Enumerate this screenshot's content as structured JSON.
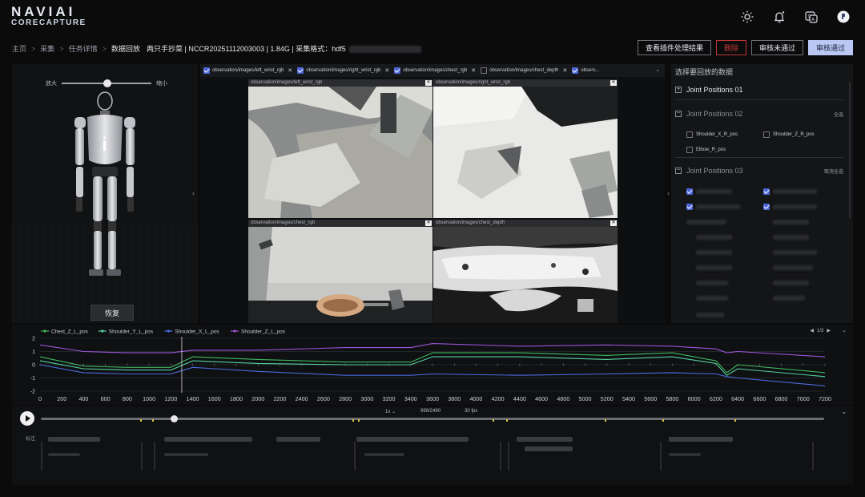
{
  "brand": {
    "line1": "NAVIAI",
    "line2": "CORECAPTURE"
  },
  "header_icons": [
    "sun-icon",
    "bell-icon",
    "translate-icon",
    "avatar"
  ],
  "breadcrumb": [
    {
      "label": "主页"
    },
    {
      "label": "采集"
    },
    {
      "label": "任务详情"
    },
    {
      "label": "数据回放"
    }
  ],
  "task_info": "两只手抄菜 | NCCR20251112003003 | 1.84G | 采集格式：hdf5",
  "actions": {
    "view_plugin": "查看插件处理结果",
    "delete": "删除",
    "reject": "审核未通过",
    "approve": "审核通过"
  },
  "robot_panel": {
    "zoom_in_label": "放大",
    "zoom_out_label": "缩小",
    "zoom_level": 0.5,
    "reset_label": "恢复"
  },
  "camera_tabs": [
    {
      "label": "observation/images/left_wrist_rgb",
      "checked": true
    },
    {
      "label": "observation/images/right_wrist_rgb",
      "checked": true
    },
    {
      "label": "observation/images/chest_rgb",
      "checked": true
    },
    {
      "label": "observation/images/chest_depth",
      "checked": false
    },
    {
      "label": "observ...",
      "checked": true
    }
  ],
  "camera_views": [
    {
      "title": "observation/images/left_wrist_rgb"
    },
    {
      "title": "observation/images/right_wrist_rgb"
    },
    {
      "title": "observation/images/chest_rgb"
    },
    {
      "title": "observation/images/chest_depth"
    }
  ],
  "data_panel": {
    "title": "选择要回放的数据",
    "group1": {
      "name": "Joint Positions 01",
      "toggle": "+"
    },
    "group2": {
      "name": "Joint Positions 02",
      "toggle": "−",
      "action": "全选",
      "options": [
        {
          "label": "Shoulder_X_R_pos",
          "checked": false
        },
        {
          "label": "Shoulder_Z_R_pos",
          "checked": false
        },
        {
          "label": "Elbow_R_pos",
          "checked": false
        }
      ]
    },
    "group3": {
      "name": "Joint Positions 03",
      "toggle": "−",
      "action": "取消全选"
    }
  },
  "chart_data": {
    "type": "line",
    "x": [
      0,
      400,
      800,
      1200,
      1400,
      2000,
      2800,
      3400,
      3600,
      4400,
      5200,
      5800,
      6200,
      6300,
      6400,
      7200
    ],
    "series": [
      {
        "name": "Chest_Z_L_pos",
        "color": "#3fb85f",
        "values": [
          0.6,
          -0.1,
          -0.2,
          -0.2,
          0.6,
          0.4,
          0.2,
          0.2,
          0.9,
          0.9,
          0.7,
          0.9,
          0.3,
          -0.6,
          0.0,
          -0.6
        ]
      },
      {
        "name": "Shoulder_Y_L_pos",
        "color": "#56d2a0",
        "values": [
          0.3,
          -0.3,
          -0.4,
          -0.4,
          0.3,
          0.1,
          0.0,
          0.0,
          0.6,
          0.6,
          0.4,
          0.6,
          0.1,
          -0.8,
          -0.3,
          -0.9
        ]
      },
      {
        "name": "Shoulder_X_L_pos",
        "color": "#4a6de0",
        "values": [
          0.0,
          -0.6,
          -0.7,
          -0.7,
          -0.2,
          -0.5,
          -0.8,
          -0.8,
          -0.7,
          -0.8,
          -0.7,
          -0.6,
          -0.7,
          -0.9,
          -1.0,
          -1.6
        ]
      },
      {
        "name": "Shoulder_Z_L_pos",
        "color": "#9a55d8",
        "values": [
          1.5,
          1.0,
          0.9,
          0.9,
          1.1,
          1.1,
          1.3,
          1.3,
          1.6,
          1.4,
          1.5,
          1.4,
          1.2,
          0.9,
          1.0,
          0.6
        ]
      }
    ],
    "xticks": [
      0,
      200,
      400,
      600,
      800,
      1000,
      1200,
      1400,
      1600,
      1800,
      2000,
      2200,
      2400,
      2600,
      2800,
      3000,
      3200,
      3400,
      3600,
      3800,
      4000,
      4200,
      4400,
      4600,
      4800,
      5000,
      5200,
      5400,
      5600,
      5800,
      6000,
      6200,
      6400,
      6600,
      6800,
      7000,
      7200
    ],
    "yticks": [
      2,
      1,
      0,
      -1,
      -2
    ],
    "xlim": [
      0,
      7200
    ],
    "ylim": [
      -2,
      2
    ],
    "cursor_x": 1300,
    "legend": "top-left",
    "grid": true
  },
  "chart_pager": "1/3",
  "timeline": {
    "speed": "1x",
    "frame": "999/2490",
    "fps": "30 fps",
    "progress": 0.17,
    "track_label": "标注"
  }
}
